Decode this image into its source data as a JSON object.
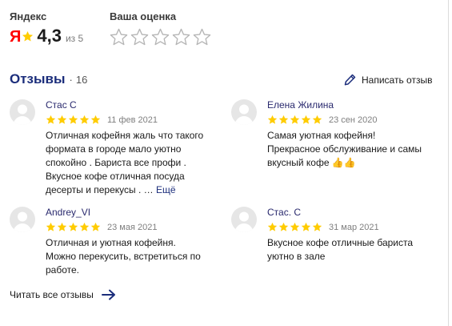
{
  "header": {
    "source_caption": "Яндекс",
    "logo_letter": "Я",
    "rating_value": "4,3",
    "rating_of": "из 5",
    "your_rating_caption": "Ваша оценка",
    "your_rating_stars": [
      1,
      2,
      3,
      4,
      5
    ]
  },
  "reviews_section": {
    "title": "Отзывы",
    "dot": "·",
    "count": "16",
    "write_label": "Написать отзыв"
  },
  "reviews": [
    {
      "author": "Стас С",
      "stars": 5,
      "date": "11 фев 2021",
      "text": "Отличная кофейня жаль что такого\nформата в городе мало уютно\nспокойно . Бариста все профи .\nВкусное кофе отличная посуда\nдесерты и перекусы . … ",
      "more": "Ещё"
    },
    {
      "author": "Елена Жилина",
      "stars": 5,
      "date": "23 сен 2020",
      "text": "Самая уютная кофейня!\nПрекрасное обслуживание и самы\nвкусный кофе 👍👍",
      "more": ""
    },
    {
      "author": "Andrey_VI",
      "stars": 5,
      "date": "23 мая 2021",
      "text": "Отличная и уютная кофейня.\nМожно перекусить, встретиться по\nработе.",
      "more": ""
    },
    {
      "author": "Стас. С",
      "stars": 5,
      "date": "31 мар 2021",
      "text": "Вкусное кофе отличные бариста\nуютно в зале",
      "more": ""
    }
  ],
  "footer": {
    "all_reviews_label": "Читать все отзывы"
  },
  "colors": {
    "accent_navy": "#1b2d7b",
    "star_gold": "#fc0",
    "logo_red": "#ff0000",
    "empty_star_stroke": "#b5b5b5",
    "avatar_bg": "#e6e6e6"
  },
  "icons": {
    "logo": "yandex-logo-icon",
    "empty_star": "empty-star-icon",
    "filled_star": "star-icon",
    "write": "pencil-icon",
    "arrow": "arrow-right-icon",
    "avatar": "user-avatar-icon"
  }
}
